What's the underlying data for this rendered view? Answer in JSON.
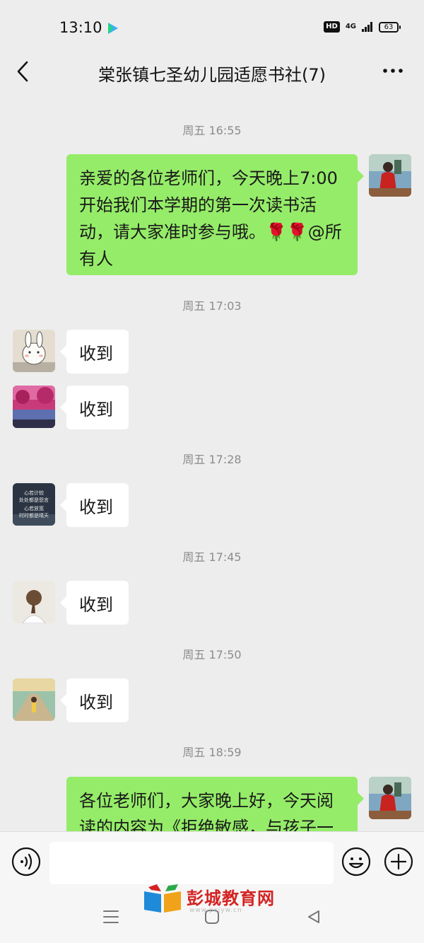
{
  "status_bar": {
    "time": "13:10",
    "hd": "HD",
    "network": "4G",
    "battery": "63"
  },
  "header": {
    "title": "棠张镇七圣幼儿园适愿书社(7)"
  },
  "messages": {
    "ts1": "周五 16:55",
    "m1": "亲爱的各位老师们，今天晚上7:00开始我们本学期的第一次读书活动，请大家准时参与哦。🌹🌹@所有人",
    "ts2": "周五 17:03",
    "m2": "收到",
    "m3": "收到",
    "ts3": "周五 17:28",
    "m4": "收到",
    "ts4": "周五 17:45",
    "m5": "收到",
    "ts5": "周五 17:50",
    "m6": "收到",
    "ts6": "周五 18:59",
    "m7": "各位老师们，大家晚上好，今天阅读的内容为《拒绝敏感，与孩子一"
  },
  "avatar3_text": [
    "心若计较",
    "处处都是怨言",
    "心若放宽",
    "时时都是晴天"
  ],
  "watermark": {
    "text": "彭城教育网",
    "url": "www.pcjyw.cn"
  },
  "colors": {
    "bubble_out": "#95ec69",
    "bubble_in": "#ffffff",
    "background": "#ededed",
    "watermark": "#d42323"
  }
}
